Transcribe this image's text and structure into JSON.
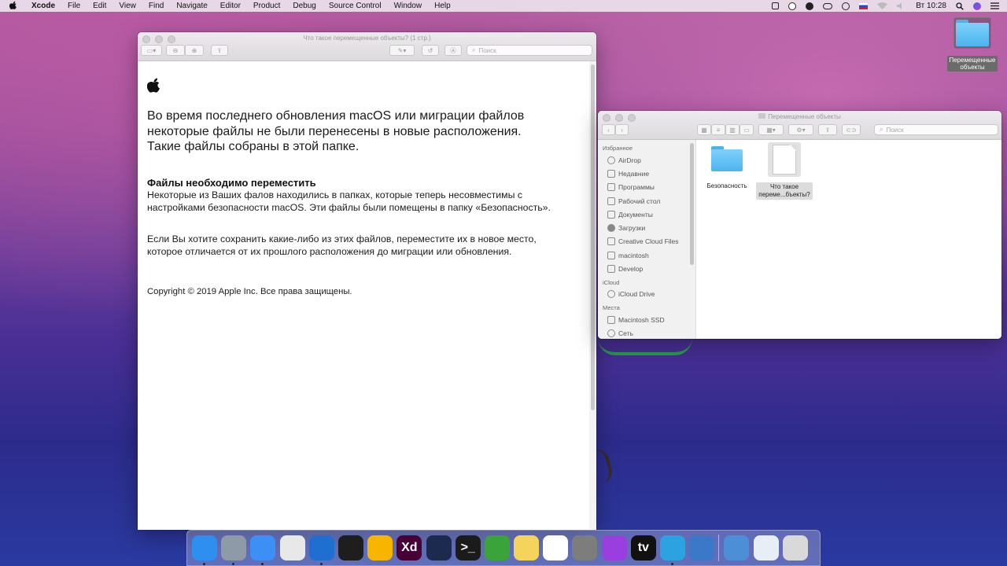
{
  "menubar": {
    "apple_icon": "apple-logo",
    "app_name": "Xcode",
    "items": [
      "File",
      "Edit",
      "View",
      "Find",
      "Navigate",
      "Editor",
      "Product",
      "Debug",
      "Source Control",
      "Window",
      "Help"
    ],
    "clock": "Вт 10:28"
  },
  "desktop_icon": {
    "label_line1": "Перемещенные",
    "label_line2": "объекты"
  },
  "preview": {
    "title": "Что такое перемещенные объекты? (1 стр.)",
    "search_placeholder": "Поиск",
    "logo": "apple-logo",
    "intro": "Во время последнего обновления macOS или миграции файлов некоторые файлы не были перенесены в новые расположения. Такие файлы собраны в этой папке.",
    "heading": "Файлы необходимо переместить",
    "para1": "Некоторые из Ваших фалов находились в папках, которые теперь несовместимы с настройками безопасности macOS. Эти файлы были помещены в папку «Безопасность».",
    "para2": "Если Вы хотите сохранить какие-либо из этих файлов, переместите их в новое место, которое отличается от их прошлого расположения до миграции или обновления.",
    "copyright": "Copyright © 2019 Apple Inc. Все права защищены."
  },
  "finder": {
    "title": "Перемещенные объекты",
    "search_placeholder": "Поиск",
    "sections": [
      {
        "header": "Избранное",
        "items": [
          "AirDrop",
          "Недавние",
          "Программы",
          "Рабочий стол",
          "Документы",
          "Загрузки",
          "Creative Cloud Files",
          "macintosh",
          "Develop"
        ]
      },
      {
        "header": "iCloud",
        "items": [
          "iCloud Drive"
        ]
      },
      {
        "header": "Места",
        "items": [
          "Macintosh SSD",
          "Сеть"
        ]
      }
    ],
    "files": [
      {
        "name": "Безопасность"
      },
      {
        "name_line1": "Что такое",
        "name_line2": "переме...бъекты?"
      }
    ]
  },
  "dock": {
    "apps": [
      {
        "name": "Finder",
        "color": "#2f8ff0"
      },
      {
        "name": "Launchpad",
        "color": "#8e9aa8"
      },
      {
        "name": "Safari",
        "color": "#3b8ff5"
      },
      {
        "name": "Chrome",
        "color": "#e8e8e8"
      },
      {
        "name": "Xcode",
        "color": "#1f6fd1"
      },
      {
        "name": "Figma",
        "color": "#1e1e1e"
      },
      {
        "name": "Sketch",
        "color": "#f7b500"
      },
      {
        "name": "Xd",
        "color": "#470137",
        "text": "Xd"
      },
      {
        "name": "Affinity Designer",
        "color": "#1b2a4e"
      },
      {
        "name": "Terminal",
        "color": "#1b1b1b",
        "text": ">_"
      },
      {
        "name": "Leaf",
        "color": "#3aa33a"
      },
      {
        "name": "Notes",
        "color": "#f4d45a"
      },
      {
        "name": "Slack",
        "color": "#ffffff"
      },
      {
        "name": "System Preferences",
        "color": "#7d7d7d"
      },
      {
        "name": "Podcasts",
        "color": "#9b3ee0"
      },
      {
        "name": "TV",
        "color": "#111111",
        "text": "tv"
      },
      {
        "name": "Telegram",
        "color": "#2ca3e0"
      },
      {
        "name": "Preview",
        "color": "#3c78c8"
      }
    ],
    "right": [
      {
        "name": "Downloads stack",
        "color": "#4d8fd6"
      },
      {
        "name": "Documents stack",
        "color": "#e8eef5"
      },
      {
        "name": "Trash",
        "color": "#d9d9d9"
      }
    ]
  }
}
